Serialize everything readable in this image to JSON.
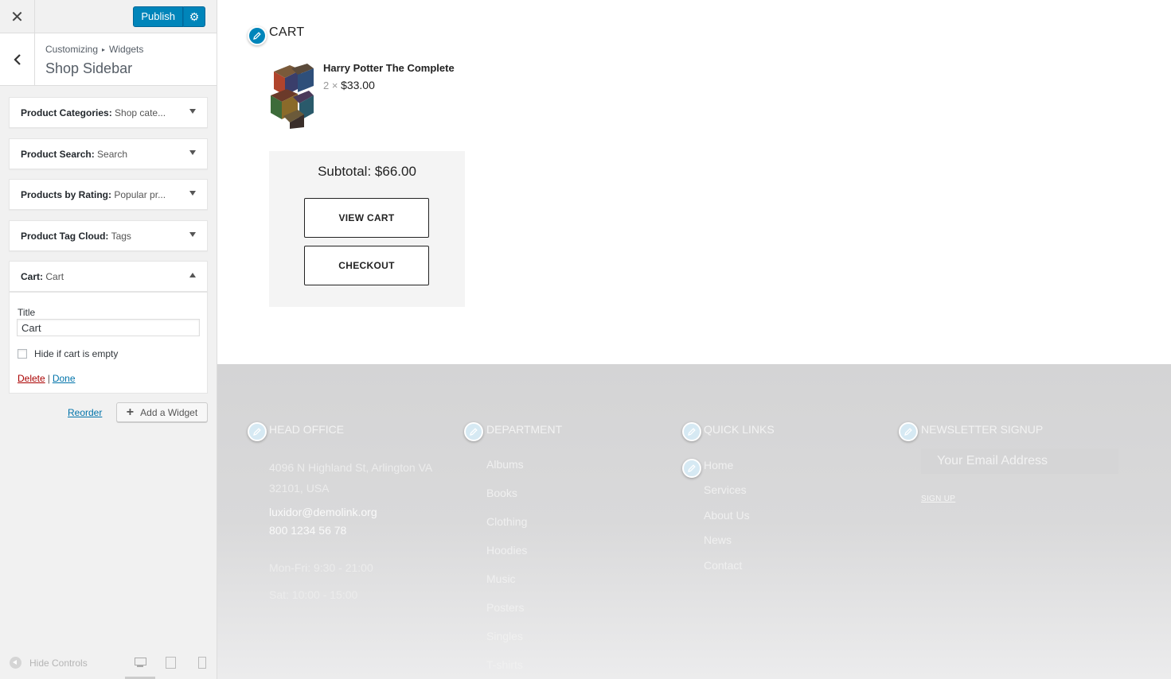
{
  "customizer": {
    "publish_label": "Publish",
    "breadcrumb_root": "Customizing",
    "breadcrumb_current": "Widgets",
    "section_title": "Shop Sidebar",
    "widgets": [
      {
        "type": "Product Categories:",
        "title": "Shop cate..."
      },
      {
        "type": "Product Search:",
        "title": "Search"
      },
      {
        "type": "Products by Rating:",
        "title": "Popular pr..."
      },
      {
        "type": "Product Tag Cloud:",
        "title": "Tags"
      },
      {
        "type": "Cart:",
        "title": "Cart"
      }
    ],
    "open_widget": {
      "title_label": "Title",
      "title_value": "Cart",
      "hide_empty_label": "Hide if cart is empty",
      "hide_empty_checked": false,
      "delete_label": "Delete",
      "separator": "|",
      "done_label": "Done"
    },
    "reorder_label": "Reorder",
    "add_widget_label": "Add a Widget",
    "hide_controls_label": "Hide Controls"
  },
  "preview": {
    "cart": {
      "heading": "CART",
      "product_name": "Harry Potter The Complete",
      "quantity": "2 ×",
      "unit_price": "$33.00",
      "subtotal": "Subtotal: $66.00",
      "view_cart_label": "VIEW CART",
      "checkout_label": "CHECKOUT"
    },
    "footer": {
      "head_office": {
        "heading": "HEAD OFFICE",
        "address_line1": "4096 N Highland St, Arlington VA",
        "address_line2": "32101, USA",
        "email": "luxidor@demolink.org",
        "phone": "800 1234 56 78",
        "hours_weekday": "Mon-Fri: 9:30 - 21:00",
        "hours_saturday": "Sat: 10:00 - 15:00"
      },
      "department": {
        "heading": "DEPARTMENT",
        "items": [
          "Albums",
          "Books",
          "Clothing",
          "Hoodies",
          "Music",
          "Posters",
          "Singles",
          "T-shirts"
        ]
      },
      "quick_links": {
        "heading": "QUICK LINKS",
        "items": [
          "Home",
          "Services",
          "About Us",
          "News",
          "Contact"
        ]
      },
      "newsletter": {
        "heading": "NEWSLETTER SIGNUP",
        "email_placeholder": "Your Email Address",
        "signup_label": "SIGN UP"
      }
    }
  },
  "colors": {
    "accent": "#0085ba",
    "delete": "#aa0000",
    "link": "#0073aa"
  }
}
